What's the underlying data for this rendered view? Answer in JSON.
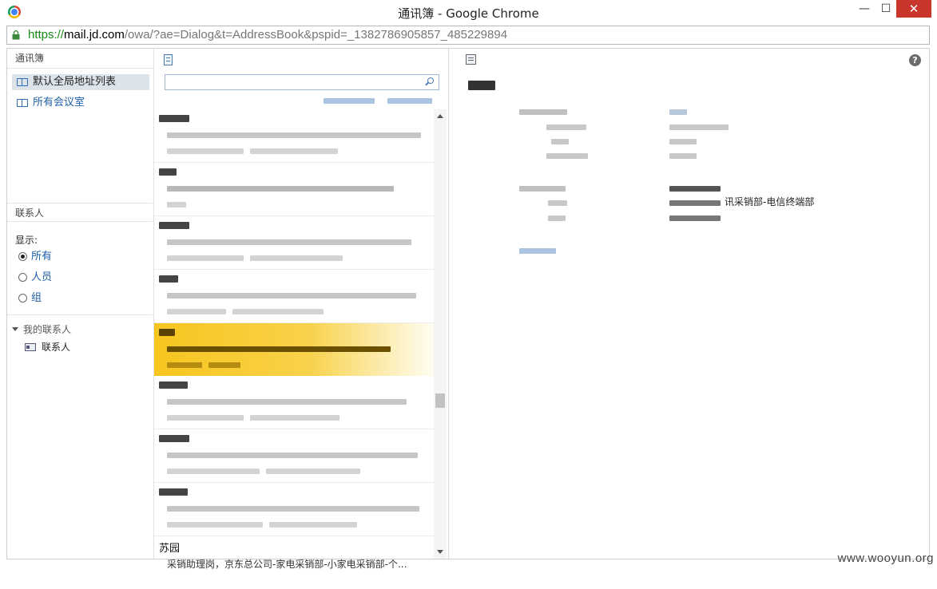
{
  "window": {
    "title": "通讯簿 - Google Chrome",
    "minimize_glyph": "—",
    "maximize_glyph": "☐",
    "close_glyph": "✕"
  },
  "address": {
    "scheme": "https://",
    "host": "mail.jd.com",
    "path": "/owa/?ae=Dialog&t=AddressBook&pspid=_1382786905857_485229894"
  },
  "nav": {
    "header": "通讯簿",
    "lists": [
      {
        "label": "默认全局地址列表",
        "selected": true
      },
      {
        "label": "所有会议室",
        "selected": false
      }
    ],
    "contacts_header": "联系人",
    "show_label": "显示:",
    "filters": [
      {
        "label": "所有",
        "checked": true
      },
      {
        "label": "人员",
        "checked": false
      },
      {
        "label": "组",
        "checked": false
      }
    ],
    "my_contacts": "我的联系人",
    "contacts_folder": "联系人"
  },
  "list": {
    "last_entry": {
      "name": "苏园",
      "description": "采销助理岗，京东总公司-家电采销部-小家电采销部-个..."
    }
  },
  "detail": {
    "department_text": "讯采销部-电信终端部"
  },
  "watermark": "www.wooyun.org",
  "colors": {
    "selection_yellow": "#f7c51e",
    "link_blue": "#1f5fa8",
    "close_red": "#c7352b",
    "https_green": "#1a8a1a"
  }
}
